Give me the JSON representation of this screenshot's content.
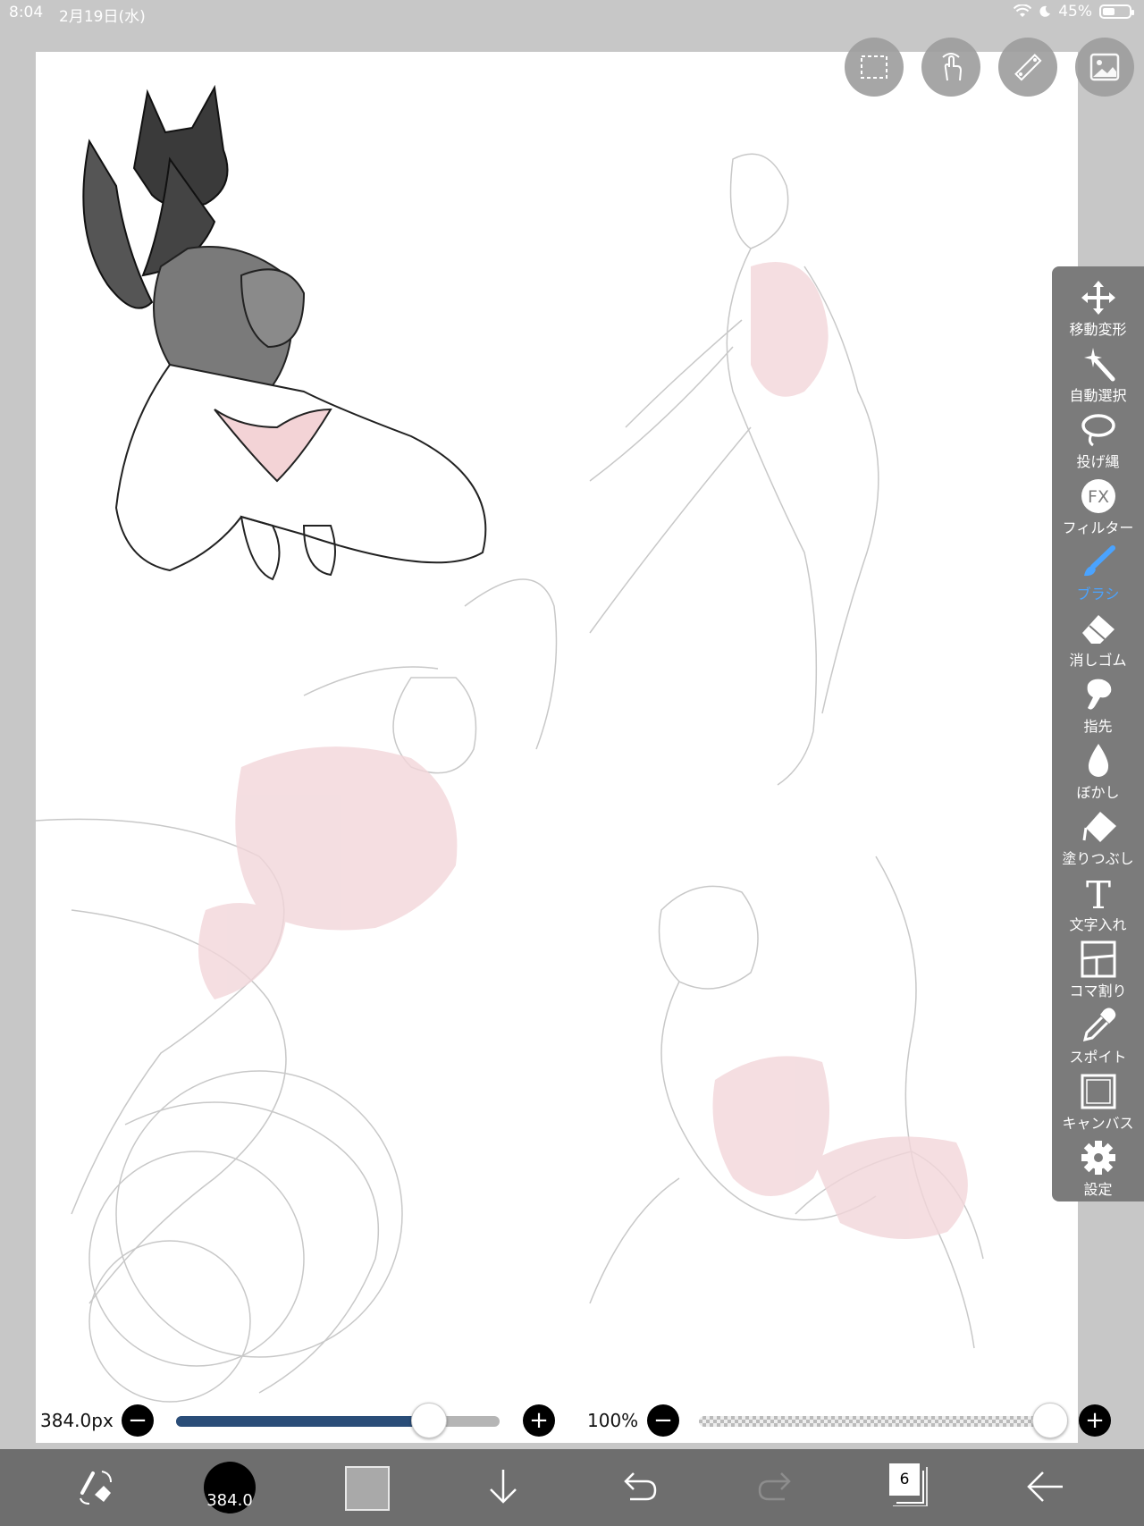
{
  "status_bar": {
    "time": "8:04",
    "date": "2月19日(水)",
    "battery": "45%",
    "battery_level": 0.45
  },
  "top_buttons": [
    {
      "name": "selection-icon"
    },
    {
      "name": "gesture-icon"
    },
    {
      "name": "ruler-icon"
    },
    {
      "name": "image-icon"
    }
  ],
  "toolbar": {
    "items": [
      {
        "label": "移動変形",
        "icon": "move-transform-icon"
      },
      {
        "label": "自動選択",
        "icon": "magic-wand-icon"
      },
      {
        "label": "投げ縄",
        "icon": "lasso-icon"
      },
      {
        "label": "フィルター",
        "icon": "filter-fx-icon",
        "badge": "FX"
      },
      {
        "label": "ブラシ",
        "icon": "brush-icon",
        "active": true
      },
      {
        "label": "消しゴム",
        "icon": "eraser-icon"
      },
      {
        "label": "指先",
        "icon": "finger-smudge-icon"
      },
      {
        "label": "ぼかし",
        "icon": "blur-drop-icon"
      },
      {
        "label": "塗りつぶし",
        "icon": "fill-bucket-icon"
      },
      {
        "label": "文字入れ",
        "icon": "text-icon",
        "glyph": "T"
      },
      {
        "label": "コマ割り",
        "icon": "panel-divide-icon"
      },
      {
        "label": "スポイト",
        "icon": "eyedropper-icon"
      },
      {
        "label": "キャンバス",
        "icon": "canvas-icon"
      },
      {
        "label": "設定",
        "icon": "settings-gear-icon"
      }
    ],
    "active_color": "#4aa3ff"
  },
  "brush_size": {
    "value_label": "384.0px",
    "minus": "−",
    "plus": "+",
    "level": 0.78
  },
  "opacity": {
    "value_label": "100%",
    "minus": "−",
    "plus": "+",
    "level": 1.0
  },
  "bottom_bar": {
    "brush_circle_label": "384.0",
    "layer_count": "6",
    "current_color": "#a9a9a9"
  }
}
